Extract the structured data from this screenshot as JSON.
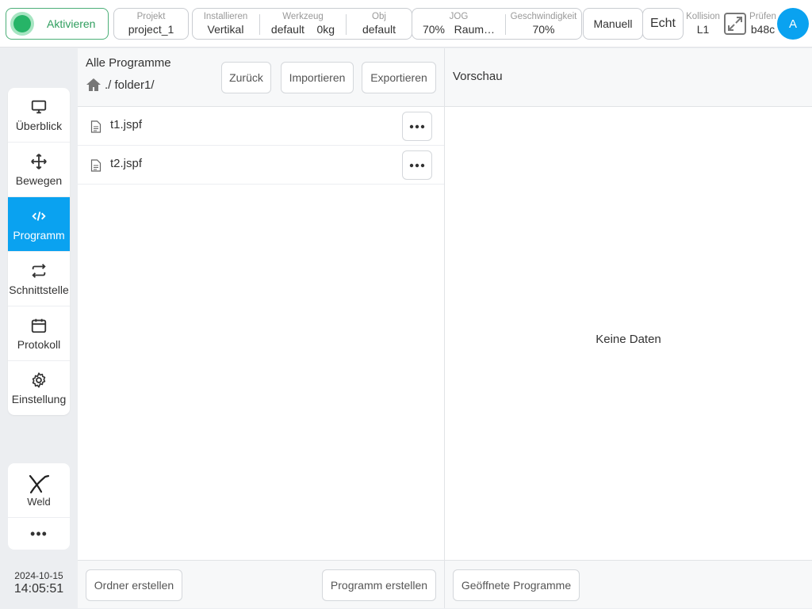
{
  "topbar": {
    "activate_label": "Aktivieren",
    "project": {
      "caption": "Projekt",
      "value": "project_1"
    },
    "install": {
      "caption": "Installieren",
      "value": "Vertikal"
    },
    "tool": {
      "caption": "Werkzeug",
      "value": "default",
      "extra": "0kg"
    },
    "obj": {
      "caption": "Obj",
      "value": "default"
    },
    "jog": {
      "caption": "JOG",
      "value": "70%",
      "extra": "Raum…"
    },
    "speed": {
      "caption": "Geschwindigkeit",
      "value": "70%"
    },
    "mode_button": "Manuell",
    "real_button": "Echt",
    "collision": {
      "caption": "Kollision",
      "value": "L1"
    },
    "check": {
      "caption": "Prüfen",
      "value": "b48c"
    },
    "avatar": "A",
    "active_color": "#26b467"
  },
  "nav": {
    "items": [
      {
        "label": "Überblick",
        "icon": "monitor-icon"
      },
      {
        "label": "Bewegen",
        "icon": "move-icon"
      },
      {
        "label": "Programm",
        "icon": "code-icon",
        "active": true
      },
      {
        "label": "Schnittstelle",
        "icon": "swap-icon"
      },
      {
        "label": "Protokoll",
        "icon": "calendar-icon"
      },
      {
        "label": "Einstellung",
        "icon": "gear-icon"
      }
    ],
    "weld_label": "Weld",
    "more_label": "•••",
    "accent": "#0aa2f0"
  },
  "clock": {
    "date": "2024-10-15",
    "time": "14:05:51"
  },
  "files": {
    "title": "Alle Programme",
    "path": "./ folder1/",
    "back_button": "Zurück",
    "import_button": "Importieren",
    "export_button": "Exportieren",
    "items": [
      {
        "name": "t1.jspf"
      },
      {
        "name": "t2.jspf"
      }
    ],
    "create_folder_button": "Ordner erstellen",
    "create_program_button": "Programm erstellen"
  },
  "preview": {
    "title": "Vorschau",
    "empty_text": "Keine Daten",
    "opened_button": "Geöffnete Programme"
  }
}
